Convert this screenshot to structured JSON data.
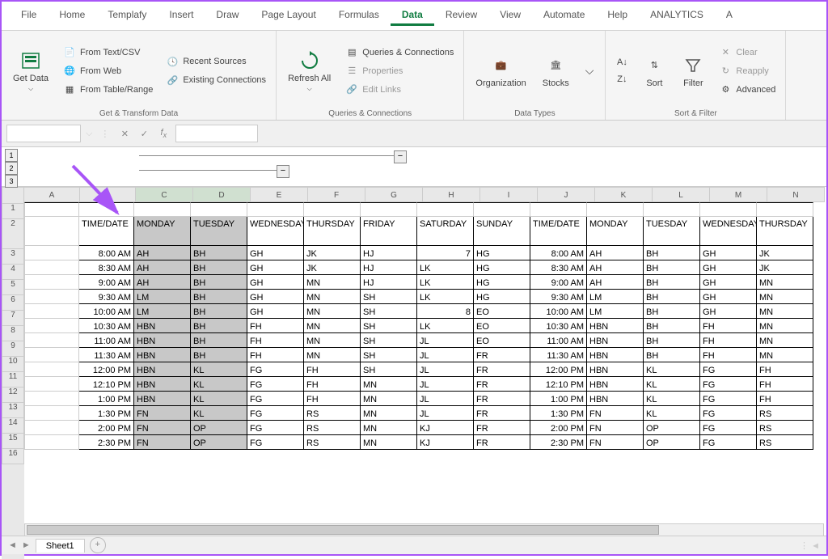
{
  "tabs": [
    "File",
    "Home",
    "Templafy",
    "Insert",
    "Draw",
    "Page Layout",
    "Formulas",
    "Data",
    "Review",
    "View",
    "Automate",
    "Help",
    "ANALYTICS",
    "A"
  ],
  "active_tab": "Data",
  "ribbon": {
    "get_data": "Get Data",
    "from_text": "From Text/CSV",
    "from_web": "From Web",
    "from_table": "From Table/Range",
    "recent": "Recent Sources",
    "existing": "Existing Connections",
    "g1": "Get & Transform Data",
    "refresh": "Refresh All",
    "queries": "Queries & Connections",
    "properties": "Properties",
    "edit_links": "Edit Links",
    "g2": "Queries & Connections",
    "org": "Organization",
    "stocks": "Stocks",
    "g3": "Data Types",
    "sort": "Sort",
    "filter": "Filter",
    "clear": "Clear",
    "reapply": "Reapply",
    "advanced": "Advanced",
    "g4": "Sort & Filter"
  },
  "cols": [
    "A",
    "B",
    "C",
    "D",
    "E",
    "F",
    "G",
    "H",
    "I",
    "J",
    "K",
    "L",
    "M",
    "N"
  ],
  "widths": [
    68,
    68,
    70,
    70,
    70,
    70,
    70,
    70,
    70,
    70,
    70,
    70,
    70,
    70
  ],
  "sel_cols": [
    2,
    3
  ],
  "headers": [
    "",
    "TIME/DATE",
    "MONDAY",
    "TUESDAY",
    "WEDNESDAY",
    "THURSDAY",
    "FRIDAY",
    "SATURDAY",
    "SUNDAY",
    "TIME/DATE",
    "MONDAY",
    "TUESDAY",
    "WEDNESDAY",
    "THURSDAY"
  ],
  "rows": [
    [
      "",
      "8:00 AM",
      "AH",
      "BH",
      "GH",
      "JK",
      "HJ",
      "7",
      "HG",
      "8:00 AM",
      "AH",
      "BH",
      "GH",
      "JK"
    ],
    [
      "",
      "8:30 AM",
      "AH",
      "BH",
      "GH",
      "JK",
      "HJ",
      "LK",
      "HG",
      "8:30 AM",
      "AH",
      "BH",
      "GH",
      "JK"
    ],
    [
      "",
      "9:00 AM",
      "AH",
      "BH",
      "GH",
      "MN",
      "HJ",
      "LK",
      "HG",
      "9:00 AM",
      "AH",
      "BH",
      "GH",
      "MN"
    ],
    [
      "",
      "9:30 AM",
      "LM",
      "BH",
      "GH",
      "MN",
      "SH",
      "LK",
      "HG",
      "9:30 AM",
      "LM",
      "BH",
      "GH",
      "MN"
    ],
    [
      "",
      "10:00 AM",
      "LM",
      "BH",
      "GH",
      "MN",
      "SH",
      "8",
      "EO",
      "10:00 AM",
      "LM",
      "BH",
      "GH",
      "MN"
    ],
    [
      "",
      "10:30 AM",
      "HBN",
      "BH",
      "FH",
      "MN",
      "SH",
      "LK",
      "EO",
      "10:30 AM",
      "HBN",
      "BH",
      "FH",
      "MN"
    ],
    [
      "",
      "11:00 AM",
      "HBN",
      "BH",
      "FH",
      "MN",
      "SH",
      "JL",
      "EO",
      "11:00 AM",
      "HBN",
      "BH",
      "FH",
      "MN"
    ],
    [
      "",
      "11:30 AM",
      "HBN",
      "BH",
      "FH",
      "MN",
      "SH",
      "JL",
      "FR",
      "11:30 AM",
      "HBN",
      "BH",
      "FH",
      "MN"
    ],
    [
      "",
      "12:00 PM",
      "HBN",
      "KL",
      "FG",
      "FH",
      "SH",
      "JL",
      "FR",
      "12:00 PM",
      "HBN",
      "KL",
      "FG",
      "FH"
    ],
    [
      "",
      "12:10 PM",
      "HBN",
      "KL",
      "FG",
      "FH",
      "MN",
      "JL",
      "FR",
      "12:10 PM",
      "HBN",
      "KL",
      "FG",
      "FH"
    ],
    [
      "",
      "1:00 PM",
      "HBN",
      "KL",
      "FG",
      "FH",
      "MN",
      "JL",
      "FR",
      "1:00 PM",
      "HBN",
      "KL",
      "FG",
      "FH"
    ],
    [
      "",
      "1:30 PM",
      "FN",
      "KL",
      "FG",
      "RS",
      "MN",
      "JL",
      "FR",
      "1:30 PM",
      "FN",
      "KL",
      "FG",
      "RS"
    ],
    [
      "",
      "2:00 PM",
      "FN",
      "OP",
      "FG",
      "RS",
      "MN",
      "KJ",
      "FR",
      "2:00 PM",
      "FN",
      "OP",
      "FG",
      "RS"
    ],
    [
      "",
      "2:30 PM",
      "FN",
      "OP",
      "FG",
      "RS",
      "MN",
      "KJ",
      "FR",
      "2:30 PM",
      "FN",
      "OP",
      "FG",
      "RS"
    ]
  ],
  "sheet": "Sheet1",
  "outline_levels": [
    "1",
    "2",
    "3"
  ]
}
